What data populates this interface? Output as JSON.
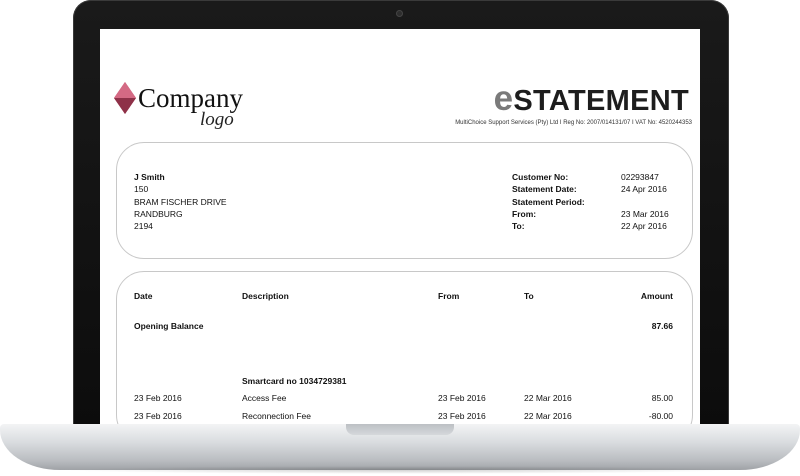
{
  "logo": {
    "company": "Company",
    "subtitle": "logo"
  },
  "header": {
    "title_first_letter": "e",
    "title_rest": "STATEMENT",
    "company_line": "MultiChoice Support Services (Pty) Ltd I Reg No: 2007/014131/07 I VAT No: 4520244353"
  },
  "address": {
    "name": "J Smith",
    "lines": [
      "150",
      "BRAM FISCHER DRIVE",
      "RANDBURG",
      "2194"
    ]
  },
  "customer": {
    "customer_no_label": "Customer No:",
    "customer_no": "02293847",
    "statement_date_label": "Statement Date:",
    "statement_date": "24 Apr 2016",
    "statement_period_label": "Statement Period:",
    "from_label": "From:",
    "from": "23 Mar 2016",
    "to_label": "To:",
    "to": "22 Apr 2016"
  },
  "table": {
    "columns": [
      "Date",
      "Description",
      "From",
      "To",
      "Amount"
    ],
    "opening_label": "Opening Balance",
    "opening_amount": "87.66",
    "smartcard_label": "Smartcard no 1034729381",
    "rows": [
      {
        "date": "23 Feb 2016",
        "description": "Access Fee",
        "from": "23 Feb 2016",
        "to": "22 Mar 2016",
        "amount": "85.00"
      },
      {
        "date": "23 Feb 2016",
        "description": "Reconnection Fee",
        "from": "23 Feb 2016",
        "to": "22 Mar 2016",
        "amount": "-80.00"
      }
    ]
  },
  "colors": {
    "logo_diamond": "#c0506a",
    "logo_diamond_dark": "#7d2a3e",
    "title_e": "#7a7a7a",
    "bezel": "#111111"
  }
}
